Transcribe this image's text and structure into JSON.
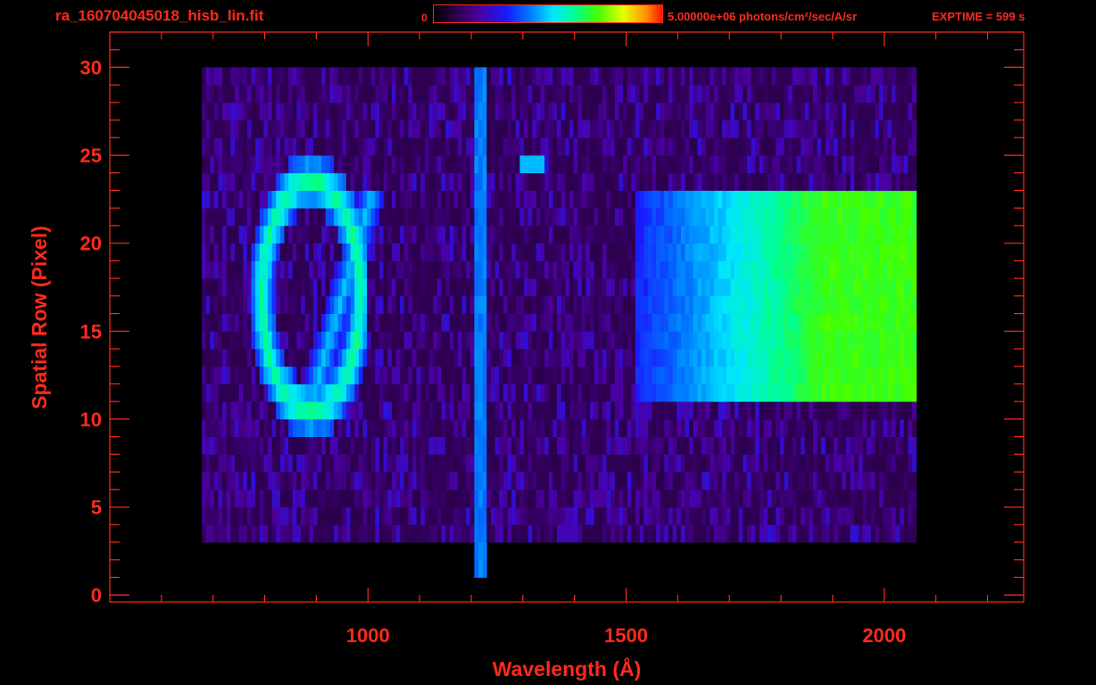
{
  "header": {
    "filename": "ra_160704045018_hisb_lin.fit",
    "colorbar_min": "0",
    "colorbar_max": "5.00000e+06 photons/cm²/sec/A/sr",
    "exptime": "EXPTIME = 599 s"
  },
  "chart_data": {
    "type": "heatmap",
    "xlabel": "Wavelength (Å)",
    "ylabel": "Spatial Row (Pixel)",
    "xlim": [
      500,
      2270
    ],
    "ylim": [
      -0.4,
      32
    ],
    "x_ticks": [
      1000,
      1500,
      2000
    ],
    "x_ticklabels": [
      "1000",
      "1500",
      "2000"
    ],
    "y_ticks": [
      0,
      5,
      10,
      15,
      20,
      25,
      30
    ],
    "y_ticklabels": [
      "0",
      "5",
      "10",
      "15",
      "20",
      "25",
      "30"
    ],
    "x_minor_step": 100,
    "y_minor_step": 1,
    "colormap": "rainbow (black-purple-blue-cyan-green-yellow-red)",
    "colorbar_range": [
      0,
      5000000
    ],
    "colorbar_units": "photons/cm2/sec/A/sr",
    "data_extent": {
      "x": [
        680,
        2070
      ],
      "rows": [
        0,
        30
      ]
    },
    "features": [
      {
        "name": "Ly-beta / O VI loop",
        "x_range": [
          800,
          1000
        ],
        "rows": [
          10,
          24
        ],
        "peak_level": 0.62
      },
      {
        "name": "Ly-alpha band",
        "x_center": 1216,
        "rows": [
          1,
          30
        ],
        "peak_level": 0.45
      },
      {
        "name": "1304 knot",
        "x_range": [
          1290,
          1340
        ],
        "rows": [
          24,
          25
        ],
        "peak_level": 0.48
      },
      {
        "name": "near-UV continuum",
        "x_range": [
          1600,
          2060
        ],
        "rows": [
          11,
          23
        ],
        "peak_level": 0.72
      }
    ],
    "grid": false,
    "legend": "none"
  },
  "colors": {
    "axes": "#ff2a1a",
    "background": "#000000"
  }
}
